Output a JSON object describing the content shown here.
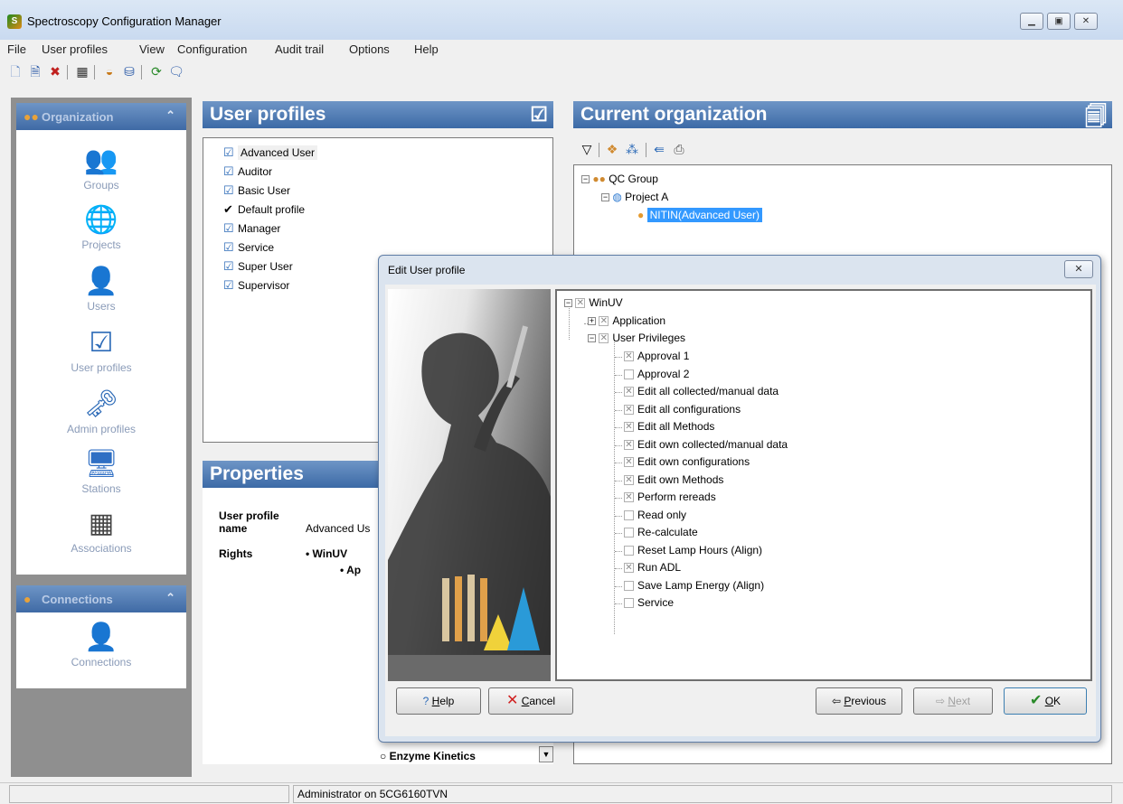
{
  "window": {
    "title": "Spectroscopy Configuration Manager"
  },
  "menu": [
    "File",
    "User profiles",
    "View",
    "Configuration",
    "Audit trail",
    "Options",
    "Help"
  ],
  "nav": {
    "organization_header": "Organization",
    "connections_header": "Connections",
    "items": [
      "Groups",
      "Projects",
      "Users",
      "User profiles",
      "Admin profiles",
      "Stations",
      "Associations"
    ],
    "connections_items": [
      "Connections"
    ]
  },
  "user_profiles": {
    "title": "User profiles",
    "items": [
      "Advanced User",
      "Auditor",
      "Basic User",
      "Default profile",
      "Manager",
      "Service",
      "Super User",
      "Supervisor"
    ],
    "selected": "Advanced User"
  },
  "properties": {
    "title": "Properties",
    "name_label_1": "User profile",
    "name_label_2": "name",
    "name_value": "Advanced Us",
    "rights_label": "Rights",
    "rights_root": "WinUV",
    "rights_child": "Ap",
    "dropdown_value": "Enzyme Kinetics"
  },
  "organization": {
    "title": "Current organization",
    "group": "QC Group",
    "project": "Project A",
    "user": "NITIN(Advanced User)"
  },
  "dialog": {
    "title": "Edit User profile",
    "root": "WinUV",
    "application": "Application",
    "user_privileges": "User Privileges",
    "privileges": [
      {
        "label": "Approval 1",
        "checked": true
      },
      {
        "label": "Approval 2",
        "checked": false
      },
      {
        "label": "Edit all collected/manual data",
        "checked": true
      },
      {
        "label": "Edit all configurations",
        "checked": true
      },
      {
        "label": "Edit all Methods",
        "checked": true
      },
      {
        "label": "Edit own collected/manual data",
        "checked": true
      },
      {
        "label": "Edit own configurations",
        "checked": true
      },
      {
        "label": "Edit own Methods",
        "checked": true
      },
      {
        "label": "Perform rereads",
        "checked": true
      },
      {
        "label": "Read only",
        "checked": false
      },
      {
        "label": "Re-calculate",
        "checked": false
      },
      {
        "label": "Reset Lamp Hours (Align)",
        "checked": false
      },
      {
        "label": "Run ADL",
        "checked": true
      },
      {
        "label": "Save Lamp Energy (Align)",
        "checked": false
      },
      {
        "label": "Service",
        "checked": false
      }
    ],
    "buttons": {
      "help_u": "H",
      "help_rest": "elp",
      "cancel_u": "C",
      "cancel_rest": "ancel",
      "previous_u": "P",
      "previous_rest": "revious",
      "next_u": "N",
      "next_rest": "ext",
      "ok_u": "O",
      "ok_rest": "K"
    }
  },
  "status": {
    "text": "Administrator on 5CG6160TVN"
  }
}
